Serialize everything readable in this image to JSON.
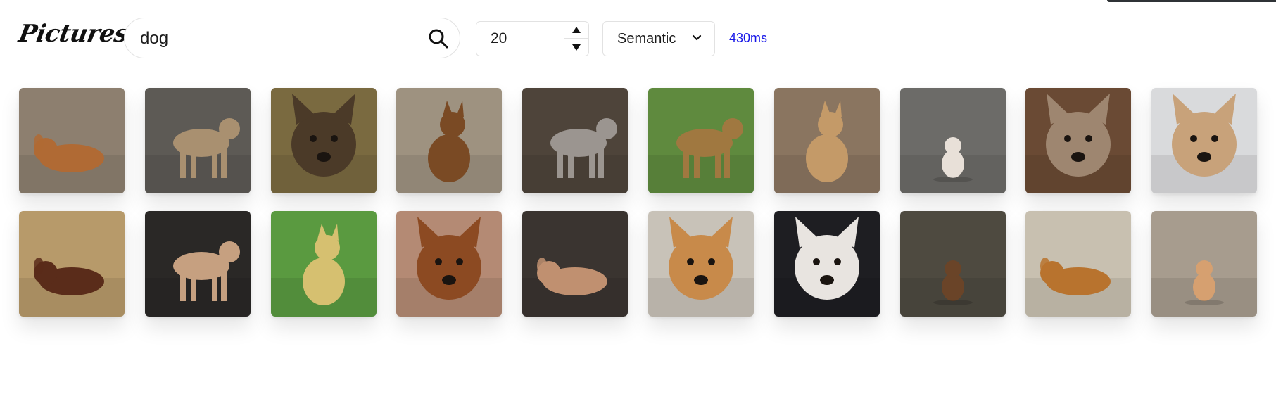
{
  "app": {
    "logo_text": "Pictures"
  },
  "search": {
    "value": "dog",
    "button_icon": "search-icon"
  },
  "count": {
    "value": "20",
    "up_icon": "triangle-up-icon",
    "down_icon": "triangle-down-icon"
  },
  "mode": {
    "selected": "Semantic",
    "icon": "chevron-down-icon"
  },
  "timing": {
    "text": "430ms",
    "color": "#1515e8"
  },
  "results": [
    {
      "name": "dog-image-1",
      "bg": "#8d7f6f",
      "fg": "#b06a34",
      "kind": "lying"
    },
    {
      "name": "dog-image-2",
      "bg": "#5d5a55",
      "fg": "#a99070",
      "kind": "standing"
    },
    {
      "name": "dog-image-3",
      "bg": "#7a6a40",
      "fg": "#4b3a28",
      "kind": "face"
    },
    {
      "name": "dog-image-4",
      "bg": "#9e9280",
      "fg": "#7a4a24",
      "kind": "sitting"
    },
    {
      "name": "dog-image-5",
      "bg": "#4e443a",
      "fg": "#9b9590",
      "kind": "standing"
    },
    {
      "name": "dog-image-6",
      "bg": "#5f8a3e",
      "fg": "#a07840",
      "kind": "standing"
    },
    {
      "name": "dog-image-7",
      "bg": "#8a7560",
      "fg": "#c49a68",
      "kind": "sitting"
    },
    {
      "name": "dog-image-8",
      "bg": "#6c6b68",
      "fg": "#e8e0d8",
      "kind": "small"
    },
    {
      "name": "dog-image-9",
      "bg": "#6a4a34",
      "fg": "#9e8670",
      "kind": "face"
    },
    {
      "name": "dog-image-10",
      "bg": "#d9dadc",
      "fg": "#c8a27a",
      "kind": "face"
    },
    {
      "name": "dog-image-11",
      "bg": "#b79a6a",
      "fg": "#5a2c1a",
      "kind": "lying"
    },
    {
      "name": "dog-image-12",
      "bg": "#2a2826",
      "fg": "#c6a080",
      "kind": "standing"
    },
    {
      "name": "dog-image-13",
      "bg": "#5a9a40",
      "fg": "#d6c070",
      "kind": "sitting"
    },
    {
      "name": "dog-image-14",
      "bg": "#b48a74",
      "fg": "#8c4a22",
      "kind": "face"
    },
    {
      "name": "dog-image-15",
      "bg": "#3a3430",
      "fg": "#c09070",
      "kind": "lying"
    },
    {
      "name": "dog-image-16",
      "bg": "#c8c2b8",
      "fg": "#c88a4a",
      "kind": "face"
    },
    {
      "name": "dog-image-17",
      "bg": "#1e1e22",
      "fg": "#e8e4e0",
      "kind": "face"
    },
    {
      "name": "dog-image-18",
      "bg": "#4e4a40",
      "fg": "#6a4428",
      "kind": "small"
    },
    {
      "name": "dog-image-19",
      "bg": "#c8c0b0",
      "fg": "#b8732e",
      "kind": "lying"
    },
    {
      "name": "dog-image-20",
      "bg": "#a79c8e",
      "fg": "#d6a070",
      "kind": "small"
    }
  ]
}
